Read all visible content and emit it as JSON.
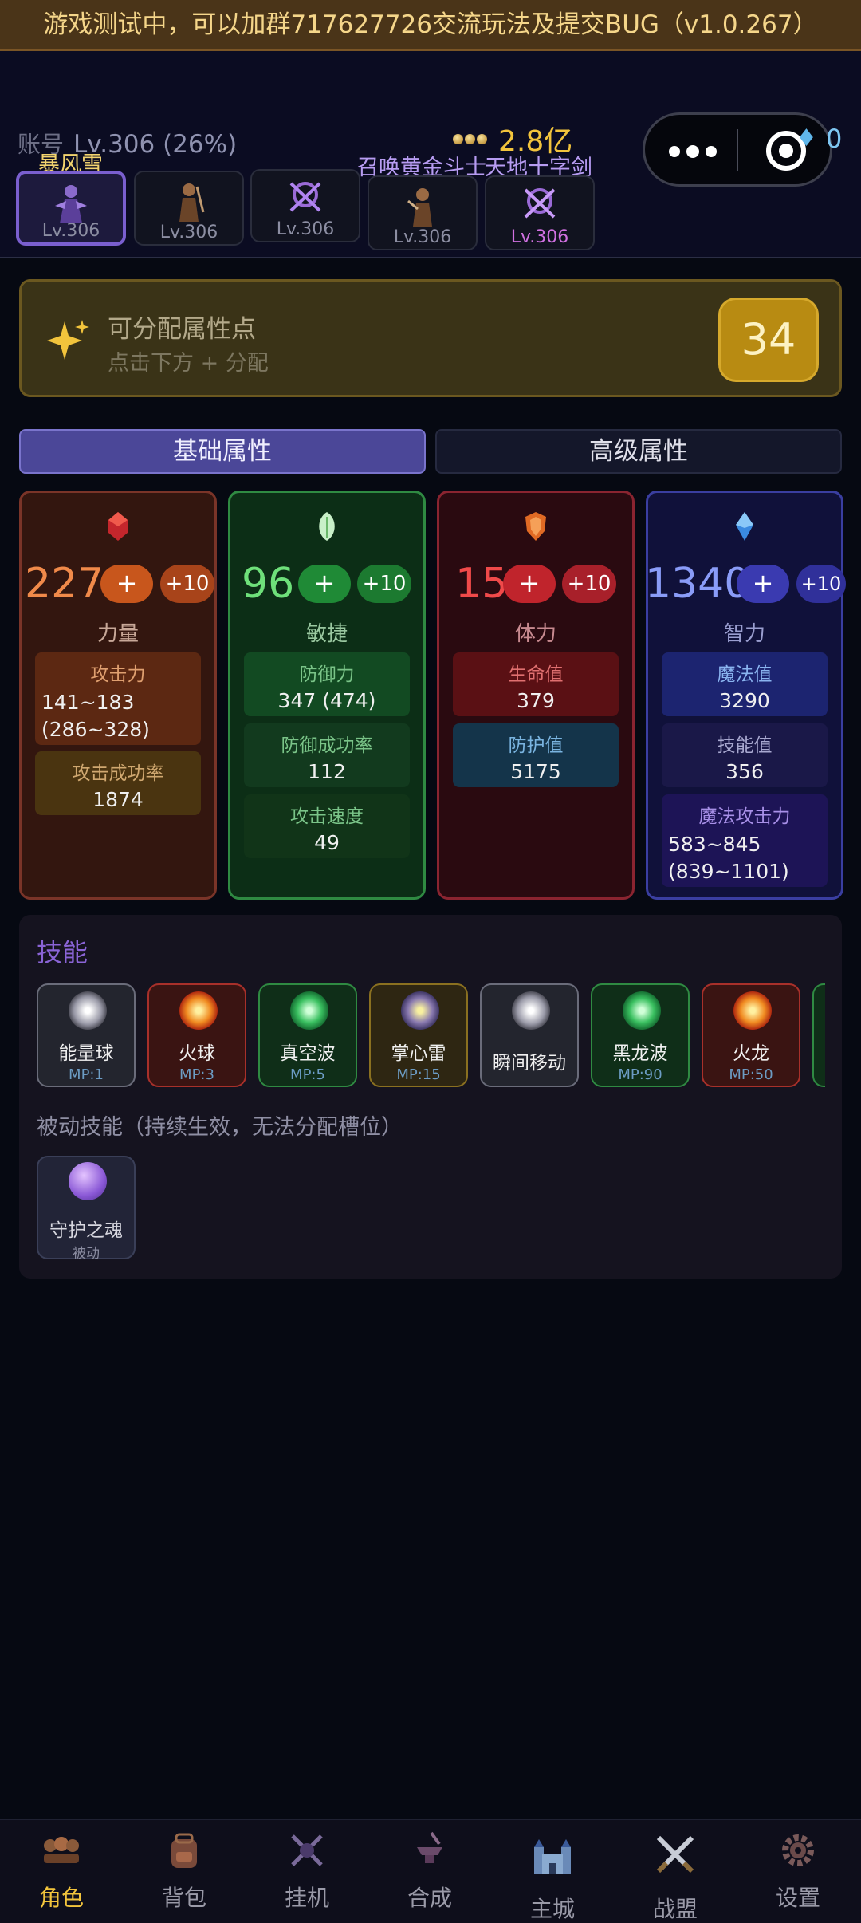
{
  "banner": {
    "text": "游戏测试中，可以加群717627726交流玩法及提交BUG（v1.0.267）"
  },
  "header": {
    "account_label": "账号",
    "account_level": "Lv.306 (26%)",
    "gold": "2.8亿",
    "diamonds": "0"
  },
  "characters": [
    {
      "name": "暴风雪",
      "level": "Lv.306",
      "selected": true
    },
    {
      "name": "",
      "level": "Lv.306",
      "selected": false
    },
    {
      "name": "",
      "level": "Lv.306",
      "selected": false
    },
    {
      "name": "召唤黄金斗士",
      "level": "Lv.306",
      "selected": false
    },
    {
      "name": "天地十字剑",
      "level": "Lv.306",
      "selected": false
    }
  ],
  "points": {
    "title": "可分配属性点",
    "hint": "点击下方 + 分配",
    "count": "34"
  },
  "tabs": {
    "basic": "基础属性",
    "advanced": "高级属性"
  },
  "stats": {
    "plus_label": "+",
    "plus10_label": "+10",
    "strength": {
      "value": "227",
      "label": "力量",
      "attack_label": "攻击力",
      "attack_value_1": "141~183",
      "attack_value_2": "(286~328)",
      "hit_rate_label": "攻击成功率",
      "hit_rate_value": "1874"
    },
    "agility": {
      "value": "96",
      "label": "敏捷",
      "defense_label": "防御力",
      "defense_value": "347 (474)",
      "def_rate_label": "防御成功率",
      "def_rate_value": "112",
      "atk_speed_label": "攻击速度",
      "atk_speed_value": "49"
    },
    "vitality": {
      "value": "15",
      "label": "体力",
      "hp_label": "生命值",
      "hp_value": "379",
      "armor_label": "防护值",
      "armor_value": "5175"
    },
    "intelligence": {
      "value": "1340",
      "label": "智力",
      "mana_label": "魔法值",
      "mana_value": "3290",
      "skill_label": "技能值",
      "skill_value": "356",
      "mag_atk_label": "魔法攻击力",
      "mag_atk_value_1": "583~845",
      "mag_atk_value_2": "(839~1101)"
    }
  },
  "skills": {
    "title": "技能",
    "items": [
      {
        "name": "能量球",
        "mp": "MP:1"
      },
      {
        "name": "火球",
        "mp": "MP:3"
      },
      {
        "name": "真空波",
        "mp": "MP:5"
      },
      {
        "name": "掌心雷",
        "mp": "MP:15"
      },
      {
        "name": "瞬间移动",
        "mp": ""
      },
      {
        "name": "黑龙波",
        "mp": "MP:90"
      },
      {
        "name": "火龙",
        "mp": "MP:50"
      }
    ],
    "passive_title": "被动技能（持续生效，无法分配槽位）",
    "passive": {
      "name": "守护之魂",
      "tag": "被动"
    }
  },
  "nav": [
    {
      "label": "角色",
      "icon": "heroes-icon",
      "active": true
    },
    {
      "label": "背包",
      "icon": "backpack-icon",
      "active": false
    },
    {
      "label": "挂机",
      "icon": "idle-icon",
      "active": false
    },
    {
      "label": "合成",
      "icon": "anvil-icon",
      "active": false
    },
    {
      "label": "主城",
      "icon": "castle-icon",
      "active": false
    },
    {
      "label": "战盟",
      "icon": "crossed-swords-icon",
      "active": false
    },
    {
      "label": "设置",
      "icon": "gear-icon",
      "active": false
    }
  ],
  "colors": {
    "gold": "#f2c43c",
    "strength": "#f08a4a",
    "agility": "#6ee07a",
    "vitality": "#f04a4a",
    "intelligence": "#8a9cf8",
    "accent": "#4b4798"
  }
}
